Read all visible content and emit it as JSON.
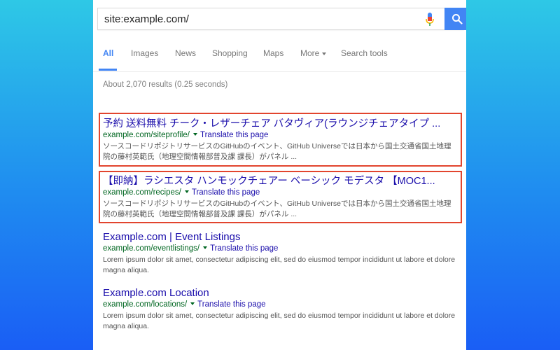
{
  "search": {
    "query": "site:example.com/"
  },
  "tabs": {
    "all": "All",
    "images": "Images",
    "news": "News",
    "shopping": "Shopping",
    "maps": "Maps",
    "more": "More",
    "tools": "Search tools"
  },
  "stats": "About 2,070 results (0.25 seconds)",
  "results": [
    {
      "title": "予約 送料無料 チーク・レザーチェア バタヴィア(ラウンジチェアタイプ ...",
      "url": "example.com/siteprofile/",
      "translate": "Translate this page",
      "snippet": "ソースコードリポジトリサービスのGitHubのイベント、GitHub Universeでは日本から国土交通省国土地理院の藤村英範氏（地理空間情報部普及課 課長）がパネル ..."
    },
    {
      "title": "【即納】ラシエスタ ハンモックチェアー ベーシック モデスタ 【MOC1...",
      "url": "example.com/recipes/",
      "translate": "Translate this page",
      "snippet": "ソースコードリポジトリサービスのGitHubのイベント、GitHub Universeでは日本から国土交通省国土地理院の藤村英範氏（地理空間情報部普及課 課長）がパネル ..."
    },
    {
      "title": "Example.com | Event Listings",
      "url": "example.com/eventlistings/",
      "translate": "Translate this page",
      "snippet": "Lorem ipsum dolor sit amet, consectetur adipiscing elit, sed do eiusmod tempor incididunt ut labore et dolore magna aliqua."
    },
    {
      "title": "Example.com Location",
      "url": "example.com/locations/",
      "translate": "Translate this page",
      "snippet": "Lorem ipsum dolor sit amet, consectetur adipiscing elit, sed do eiusmod tempor incididunt ut labore et dolore magna aliqua."
    }
  ],
  "colors": {
    "accent": "#4285f4",
    "link": "#1a0dab",
    "url": "#006621",
    "highlight": "#e2452e"
  },
  "icons": {
    "mic": "microphone-icon",
    "search": "search-icon"
  }
}
